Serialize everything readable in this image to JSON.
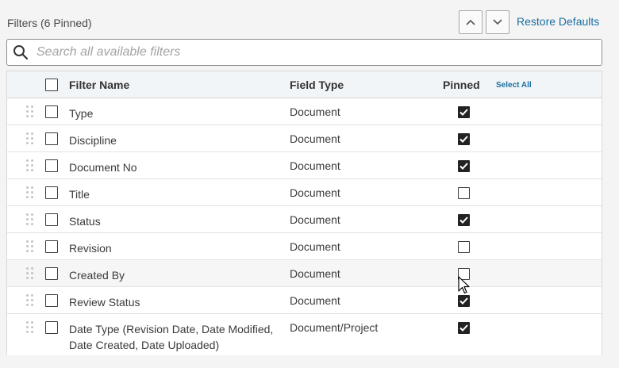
{
  "header": {
    "title": "Filters (6 Pinned)",
    "restore_label": "Restore Defaults"
  },
  "search": {
    "placeholder": "Search all available filters",
    "value": ""
  },
  "table": {
    "columns": {
      "name": "Filter Name",
      "type": "Field Type",
      "pinned": "Pinned",
      "select_all": "Select All"
    },
    "rows": [
      {
        "name": "Type",
        "type": "Document",
        "pinned": true
      },
      {
        "name": "Discipline",
        "type": "Document",
        "pinned": true
      },
      {
        "name": "Document No",
        "type": "Document",
        "pinned": true
      },
      {
        "name": "Title",
        "type": "Document",
        "pinned": false
      },
      {
        "name": "Status",
        "type": "Document",
        "pinned": true
      },
      {
        "name": "Revision",
        "type": "Document",
        "pinned": false
      },
      {
        "name": "Created By",
        "type": "Document",
        "pinned": false
      },
      {
        "name": "Review Status",
        "type": "Document",
        "pinned": true
      },
      {
        "name": "Date Type (Revision Date, Date Modified, Date Created, Date Uploaded)",
        "type": "Document/Project",
        "pinned": true
      }
    ]
  },
  "colors": {
    "link": "#1b6fa0",
    "checkbox_checked": "#222222",
    "header_bg": "#f2f5f8"
  },
  "icons": {
    "search": "search-icon",
    "up": "chevron-up-icon",
    "down": "chevron-down-icon",
    "drag": "drag-handle-icon",
    "check": "checkmark-icon",
    "cursor": "mouse-pointer-icon"
  }
}
